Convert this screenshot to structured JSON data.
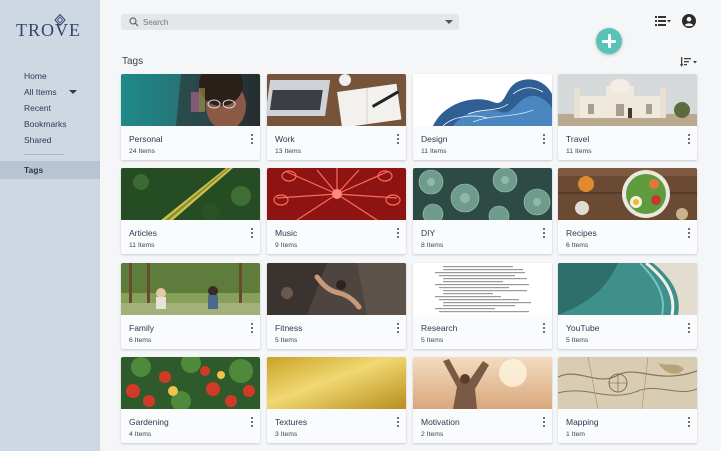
{
  "app": {
    "logo_text": "TROVE"
  },
  "sidebar": {
    "items": [
      {
        "label": "Home"
      },
      {
        "label": "All Items"
      },
      {
        "label": "Recent"
      },
      {
        "label": "Bookmarks"
      },
      {
        "label": "Shared"
      },
      {
        "label": "Tags"
      }
    ]
  },
  "search": {
    "placeholder": "Search"
  },
  "page": {
    "title": "Tags"
  },
  "colors": {
    "sidebar_bg": "#cdd8e3",
    "accent": "#59c3b8",
    "text": "#2b3a55"
  },
  "tags": [
    {
      "title": "Personal",
      "count": "24 Items",
      "image": "woman-with-glasses-photo"
    },
    {
      "title": "Work",
      "count": "13 Items",
      "image": "laptop-and-notebook-photo"
    },
    {
      "title": "Design",
      "count": "11 Items",
      "image": "wave-illustration"
    },
    {
      "title": "Travel",
      "count": "11 Items",
      "image": "palace-building-photo"
    },
    {
      "title": "Articles",
      "count": "11 Items",
      "image": "forest-road-aerial-photo"
    },
    {
      "title": "Music",
      "count": "9 Items",
      "image": "red-guitars-photo"
    },
    {
      "title": "DIY",
      "count": "8 Items",
      "image": "succulents-photo"
    },
    {
      "title": "Recipes",
      "count": "6 Items",
      "image": "food-bowl-photo"
    },
    {
      "title": "Family",
      "count": "6 Items",
      "image": "family-in-park-photo"
    },
    {
      "title": "Fitness",
      "count": "5 Items",
      "image": "rock-climber-photo"
    },
    {
      "title": "Research",
      "count": "5 Items",
      "image": "text-document"
    },
    {
      "title": "YouTube",
      "count": "5 Items",
      "image": "coastline-aerial-photo"
    },
    {
      "title": "Gardening",
      "count": "4 Items",
      "image": "tomatoes-photo"
    },
    {
      "title": "Textures",
      "count": "3 Items",
      "image": "gold-texture"
    },
    {
      "title": "Motivation",
      "count": "2 Items",
      "image": "raised-arms-sunset-photo"
    },
    {
      "title": "Mapping",
      "count": "1 Item",
      "image": "old-map"
    }
  ]
}
